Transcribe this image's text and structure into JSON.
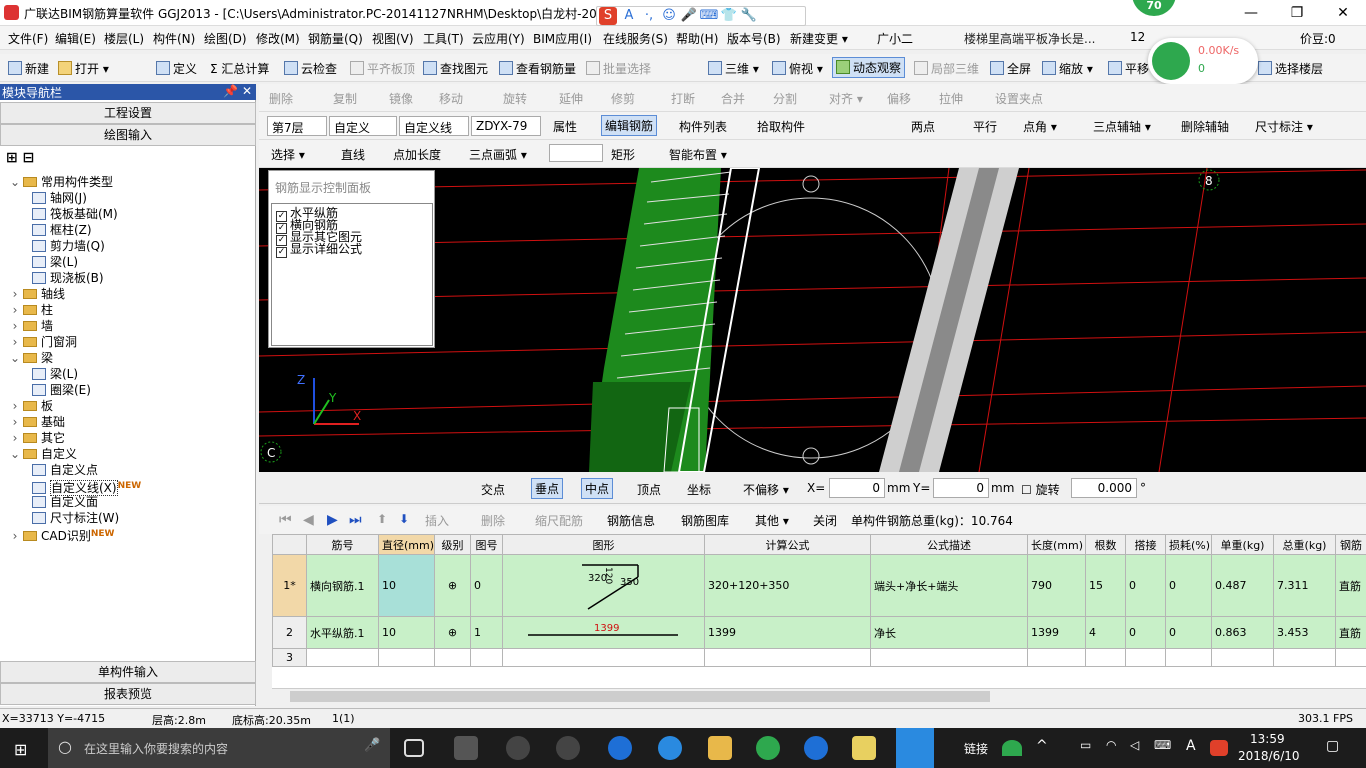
{
  "titlebar": {
    "title": "广联达BIM钢筋算量软件 GGJ2013 - [C:\\Users\\Administrator.PC-20141127NRHM\\Desktop\\白龙村-20",
    "badge": "70",
    "minimize": "—",
    "maximize": "❐",
    "close": "✕"
  },
  "ime": {
    "logo": "S",
    "a": "A",
    "dot": "·,",
    "smile": "☺",
    "mic": "🎤",
    "kbd": "⌨",
    "shirt": "👕",
    "tool": "🔧"
  },
  "menu": [
    "文件(F)",
    "编辑(E)",
    "楼层(L)",
    "构件(N)",
    "绘图(D)",
    "修改(M)",
    "钢筋量(Q)",
    "视图(V)",
    "工具(T)",
    "云应用(Y)",
    "BIM应用(I)",
    "在线服务(S)",
    "帮助(H)",
    "版本号(B)",
    "新建变更 ▾",
    "广小二",
    "楼梯里高端平板净长是...",
    "12",
    "价豆:0"
  ],
  "network": {
    "speed_up": "0.00K/s",
    "speed_down": "0"
  },
  "toolbar1": [
    "新建",
    "打开 ▾",
    "定义",
    "Σ 汇总计算",
    "云检查",
    "平齐板顶",
    "查找图元",
    "查看钢筋量",
    "批量选择",
    "三维 ▾",
    "俯视 ▾",
    "动态观察",
    "局部三维",
    "全屏",
    "缩放 ▾",
    "平移",
    "选择楼层"
  ],
  "toolbar2": [
    "删除",
    "复制",
    "镜像",
    "移动",
    "旋转",
    "延伸",
    "修剪",
    "打断",
    "合并",
    "分割",
    "对齐 ▾",
    "偏移",
    "拉伸",
    "设置夹点"
  ],
  "toolbar3": {
    "floor": "第7层",
    "type": "自定义",
    "subtype": "自定义线",
    "name": "ZDYX-79",
    "buttons": [
      "属性",
      "编辑钢筋",
      "构件列表",
      "拾取构件"
    ],
    "right": [
      "两点",
      "平行",
      "点角 ▾",
      "三点辅轴 ▾",
      "删除辅轴",
      "尺寸标注 ▾"
    ]
  },
  "toolbar4": [
    "选择 ▾",
    "直线",
    "点加长度",
    "三点画弧 ▾",
    "矩形",
    "智能布置 ▾"
  ],
  "nav": {
    "header": "模块导航栏",
    "pin": "📌 ✕",
    "btn_project": "工程设置",
    "btn_draw": "绘图输入",
    "btn_single": "单构件输入",
    "btn_report": "报表预览",
    "tree": [
      {
        "label": "常用构件类型",
        "level": 0,
        "type": "folder",
        "open": true
      },
      {
        "label": "轴网(J)",
        "level": 1,
        "type": "leaf"
      },
      {
        "label": "筏板基础(M)",
        "level": 1,
        "type": "leaf"
      },
      {
        "label": "框柱(Z)",
        "level": 1,
        "type": "leaf"
      },
      {
        "label": "剪力墙(Q)",
        "level": 1,
        "type": "leaf"
      },
      {
        "label": "梁(L)",
        "level": 1,
        "type": "leaf"
      },
      {
        "label": "现浇板(B)",
        "level": 1,
        "type": "leaf"
      },
      {
        "label": "轴线",
        "level": 0,
        "type": "folder"
      },
      {
        "label": "柱",
        "level": 0,
        "type": "folder"
      },
      {
        "label": "墙",
        "level": 0,
        "type": "folder"
      },
      {
        "label": "门窗洞",
        "level": 0,
        "type": "folder"
      },
      {
        "label": "梁",
        "level": 0,
        "type": "folder",
        "open": true
      },
      {
        "label": "梁(L)",
        "level": 1,
        "type": "leaf"
      },
      {
        "label": "圈梁(E)",
        "level": 1,
        "type": "leaf"
      },
      {
        "label": "板",
        "level": 0,
        "type": "folder"
      },
      {
        "label": "基础",
        "level": 0,
        "type": "folder"
      },
      {
        "label": "其它",
        "level": 0,
        "type": "folder"
      },
      {
        "label": "自定义",
        "level": 0,
        "type": "folder",
        "open": true
      },
      {
        "label": "自定义点",
        "level": 1,
        "type": "leaf"
      },
      {
        "label": "自定义线(X)",
        "level": 1,
        "type": "leaf",
        "new": "NEW",
        "selected": true
      },
      {
        "label": "自定义面",
        "level": 1,
        "type": "leaf"
      },
      {
        "label": "尺寸标注(W)",
        "level": 1,
        "type": "leaf"
      },
      {
        "label": "CAD识别",
        "level": 0,
        "type": "folder",
        "new": "NEW"
      }
    ]
  },
  "panel": {
    "title": "钢筋显示控制面板",
    "items": [
      {
        "label": "水平纵筋",
        "checked": "✓"
      },
      {
        "label": "横向钢筋",
        "checked": "✓"
      },
      {
        "label": "显示其它图元",
        "checked": "✓"
      },
      {
        "label": "显示详细公式",
        "checked": "✓"
      }
    ]
  },
  "viewport": {
    "axis_c": "C",
    "axis_8": "8",
    "axis_x": "X",
    "axis_y": "Y",
    "axis_z": "Z"
  },
  "snapbar": {
    "items": [
      "交点",
      "垂点",
      "中点",
      "顶点",
      "坐标",
      "不偏移 ▾"
    ],
    "x_label": "X=",
    "x_value": "0",
    "unit1": "mm",
    "y_label": "Y=",
    "y_value": "0",
    "unit2": "mm",
    "rotate": "旋转",
    "rotate_value": "0.000",
    "degree": "°"
  },
  "gridtb": {
    "items": [
      "插入",
      "删除",
      "缩尺配筋",
      "钢筋信息",
      "钢筋图库",
      "其他 ▾",
      "关闭"
    ],
    "total": "单构件钢筋总重(kg)：10.764"
  },
  "table": {
    "headers": [
      "",
      "筋号",
      "直径(mm)",
      "级别",
      "图号",
      "图形",
      "计算公式",
      "公式描述",
      "长度(mm)",
      "根数",
      "搭接",
      "损耗(%)",
      "单重(kg)",
      "总重(kg)",
      "钢筋"
    ],
    "rows": [
      {
        "idx": "1*",
        "name": "横向钢筋.1",
        "dia": "10",
        "grade": "⊕",
        "fig": "0",
        "shape_a": "320",
        "shape_b": "350",
        "shape_c": "120",
        "formula": "320+120+350",
        "desc": "端头+净长+端头",
        "len": "790",
        "count": "15",
        "lap": "0",
        "loss": "0",
        "unit_w": "0.487",
        "total_w": "7.311",
        "type": "直筋"
      },
      {
        "idx": "2",
        "name": "水平纵筋.1",
        "dia": "10",
        "grade": "⊕",
        "fig": "1",
        "shape_a": "1399",
        "formula": "1399",
        "desc": "净长",
        "len": "1399",
        "count": "4",
        "lap": "0",
        "loss": "0",
        "unit_w": "0.863",
        "total_w": "3.453",
        "type": "直筋"
      },
      {
        "idx": "3"
      }
    ]
  },
  "status": {
    "coords": "X=33713 Y=-4715",
    "floor_h": "层高:2.8m",
    "base_h": "底标高:20.35m",
    "count": "1(1)",
    "fps": "303.1 FPS"
  },
  "taskbar": {
    "search_placeholder": "在这里输入你要搜索的内容",
    "link": "链接",
    "lang": "A",
    "time": "13:59",
    "date": "2018/6/10"
  }
}
